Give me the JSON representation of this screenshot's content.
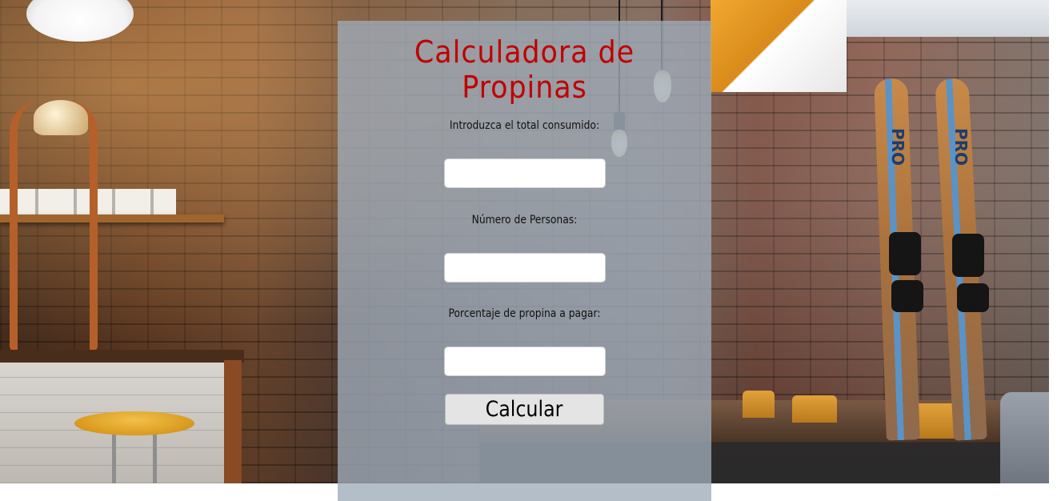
{
  "app": {
    "title": "Calculadora de Propinas",
    "title_color": "#c10000"
  },
  "form": {
    "total_label": "Introduzca el total consumido:",
    "total_value": "",
    "personas_label": "Número de Personas:",
    "personas_value": "",
    "porcentaje_label": "Porcentaje de propina a pagar:",
    "porcentaje_value": "",
    "submit_label": "Calcular"
  },
  "background": {
    "ski_text": "PRO"
  }
}
